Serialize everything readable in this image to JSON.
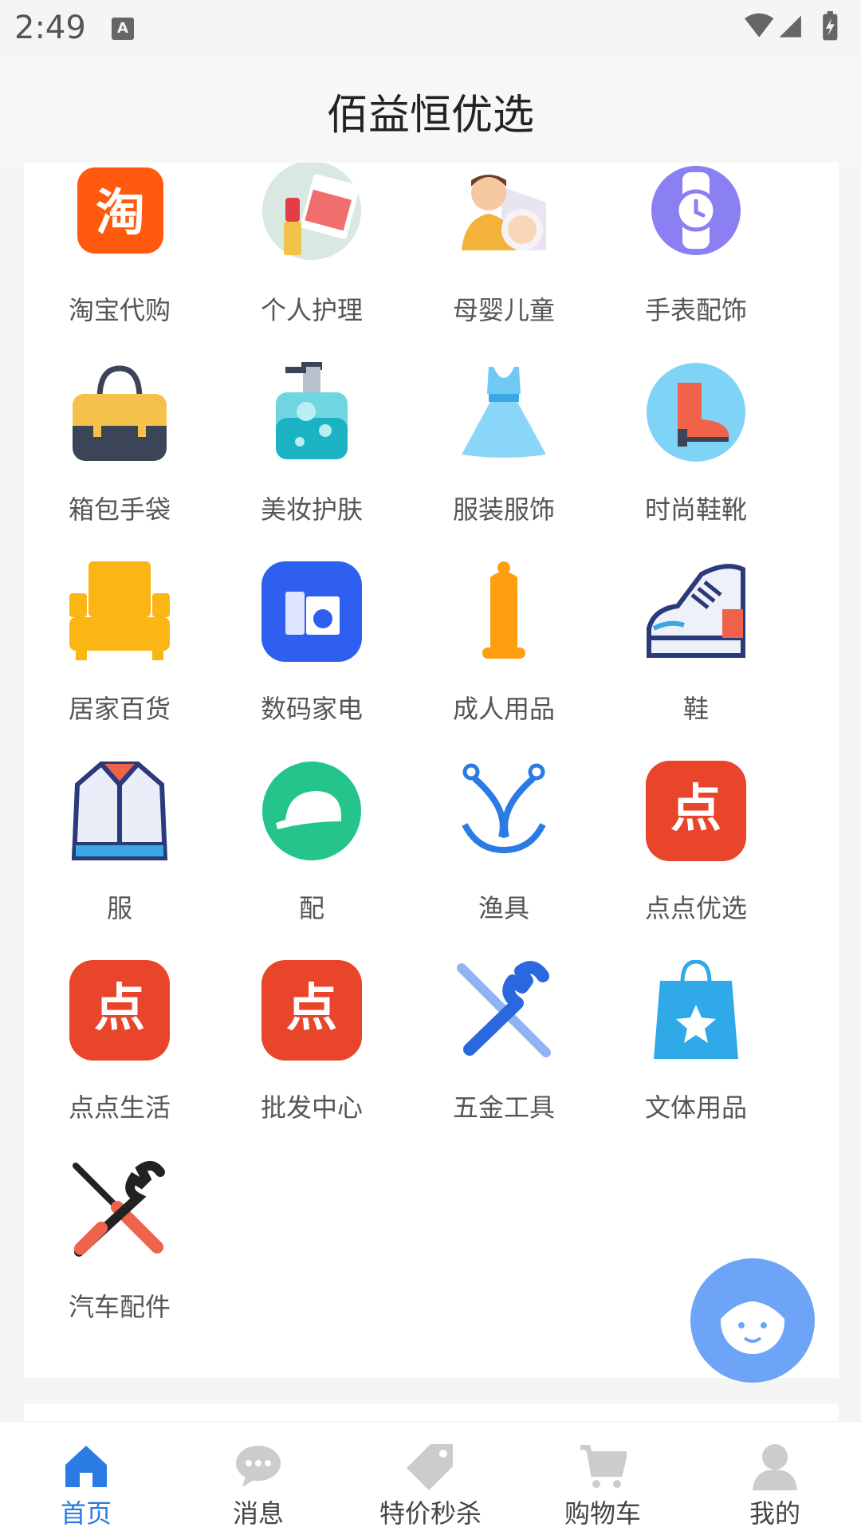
{
  "status_bar": {
    "time": "2:49",
    "a_badge": "A"
  },
  "header": {
    "title": "佰益恒优选"
  },
  "categories": [
    {
      "label": "淘宝代购",
      "icon": "taobao-icon"
    },
    {
      "label": "个人护理",
      "icon": "lipstick-icon"
    },
    {
      "label": "母婴儿童",
      "icon": "mother-baby-icon"
    },
    {
      "label": "手表配饰",
      "icon": "watch-icon"
    },
    {
      "label": "箱包手袋",
      "icon": "handbag-icon"
    },
    {
      "label": "美妆护肤",
      "icon": "lotion-bottle-icon"
    },
    {
      "label": "服装服饰",
      "icon": "dress-icon"
    },
    {
      "label": "时尚鞋靴",
      "icon": "boot-icon"
    },
    {
      "label": "居家百货",
      "icon": "sofa-icon"
    },
    {
      "label": "数码家电",
      "icon": "appliance-icon"
    },
    {
      "label": "成人用品",
      "icon": "adult-product-icon"
    },
    {
      "label": "鞋",
      "icon": "sneaker-icon"
    },
    {
      "label": "服",
      "icon": "jacket-icon"
    },
    {
      "label": "配",
      "icon": "cap-icon"
    },
    {
      "label": "渔具",
      "icon": "fishing-hook-icon"
    },
    {
      "label": "点点优选",
      "icon": "dian-logo-icon"
    },
    {
      "label": "点点生活",
      "icon": "dian-logo-icon"
    },
    {
      "label": "批发中心",
      "icon": "dian-logo-icon"
    },
    {
      "label": "五金工具",
      "icon": "wrench-screwdriver-icon"
    },
    {
      "label": "文体用品",
      "icon": "shopping-bag-star-icon"
    },
    {
      "label": "汽车配件",
      "icon": "car-tools-icon"
    }
  ],
  "tabs": [
    {
      "label": "首页",
      "icon": "home-icon",
      "active": true
    },
    {
      "label": "消息",
      "icon": "chat-bubble-icon",
      "active": false
    },
    {
      "label": "特价秒杀",
      "icon": "price-tag-icon",
      "active": false
    },
    {
      "label": "购物车",
      "icon": "cart-icon",
      "active": false
    },
    {
      "label": "我的",
      "icon": "user-icon",
      "active": false
    }
  ],
  "colors": {
    "accent": "#2a7be4",
    "fab": "#6ea4f7",
    "dian_red": "#e8452a"
  }
}
